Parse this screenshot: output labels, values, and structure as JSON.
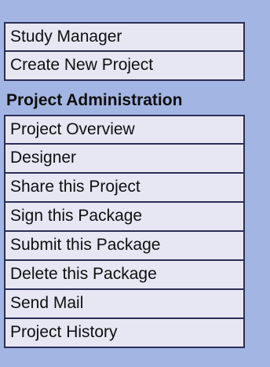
{
  "menu": {
    "top_items": [
      {
        "label": "Study Manager"
      },
      {
        "label": "Create New Project"
      }
    ],
    "section_title": "Project Administration",
    "section_items": [
      {
        "label": "Project Overview"
      },
      {
        "label": "Designer"
      },
      {
        "label": "Share this Project"
      },
      {
        "label": "Sign this Package"
      },
      {
        "label": "Submit this Package"
      },
      {
        "label": "Delete this Package"
      },
      {
        "label": "Send Mail"
      },
      {
        "label": "Project History"
      }
    ]
  },
  "colors": {
    "panel_background": "#a3b6e3",
    "item_background": "#e6e7f3",
    "item_border": "#2b2e55",
    "text": "#0f0f0f"
  }
}
